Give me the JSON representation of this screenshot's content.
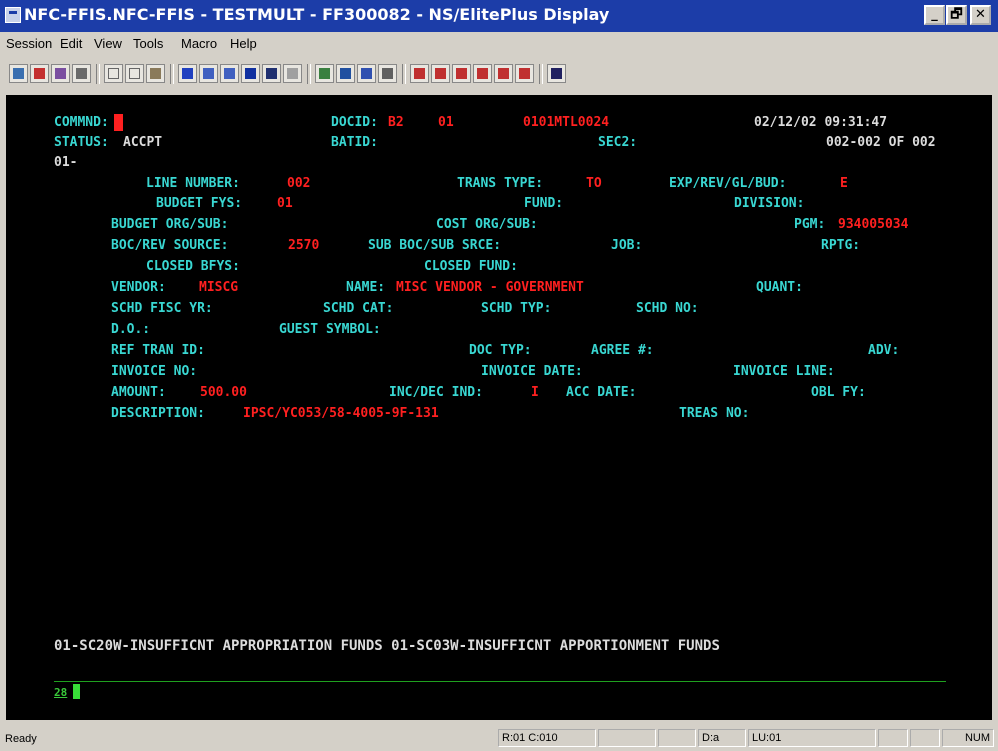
{
  "window": {
    "title": "NFC-FFIS.NFC-FFIS - TESTMULT - FF300082 - NS/ElitePlus Display",
    "minimize": "_",
    "maximize": "🗗",
    "close": "✕"
  },
  "menu": {
    "session": "Session",
    "edit": "Edit",
    "view": "View",
    "tools": "Tools",
    "macro": "Macro",
    "help": "Help"
  },
  "toolbar_icons": [
    "send-icon",
    "receive-icon",
    "copy-screen-icon",
    "print-icon",
    "cut-icon",
    "copy-icon",
    "paste-icon",
    "font-icon",
    "zoom-in-icon",
    "zoom-out-icon",
    "display-icon",
    "fit-icon",
    "connect-icon",
    "settings-icon",
    "capture-icon",
    "table-icon",
    "record-icon",
    "macro1-icon",
    "macro2-icon",
    "macro3-icon",
    "macro4-icon",
    "macro5-icon",
    "macro6-icon",
    "help-pointer-icon"
  ],
  "screen": {
    "commnd_label": "COMMND:",
    "docid_label": "DOCID:",
    "docid_1": "B2",
    "docid_2": "01",
    "docid_3": "0101MTL0024",
    "datetime": "02/12/02 09:31:47",
    "status_label": "STATUS:",
    "status_value": "ACCPT",
    "batid_label": "BATID:",
    "sec2_label": "SEC2:",
    "page_info": "002-002 OF 002",
    "section": "01-",
    "line_number_label": "LINE NUMBER:",
    "line_number": "002",
    "trans_type_label": "TRANS TYPE:",
    "trans_type": "TO",
    "exp_label": "EXP/REV/GL/BUD:",
    "exp_value": "E",
    "budget_fys_label": "BUDGET FYS:",
    "budget_fys": "01",
    "fund_label": "FUND:",
    "division_label": "DIVISION:",
    "budget_org_label": "BUDGET ORG/SUB:",
    "cost_org_label": "COST ORG/SUB:",
    "pgm_label": "PGM:",
    "pgm_value": "934005034",
    "boc_label": "BOC/REV SOURCE:",
    "boc_value": "2570",
    "sub_boc_label": "SUB BOC/SUB SRCE:",
    "job_label": "JOB:",
    "rptg_label": "RPTG:",
    "closed_bfys_label": "CLOSED BFYS:",
    "closed_fund_label": "CLOSED FUND:",
    "vendor_label": "VENDOR:",
    "vendor_value": "MISCG",
    "name_label": "NAME:",
    "name_value": "MISC VENDOR - GOVERNMENT",
    "quant_label": "QUANT:",
    "schd_fisc_label": "SCHD FISC YR:",
    "schd_cat_label": "SCHD CAT:",
    "schd_typ_label": "SCHD TYP:",
    "schd_no_label": "SCHD NO:",
    "do_label": "D.O.:",
    "guest_symbol_label": "GUEST SYMBOL:",
    "ref_tran_label": "REF TRAN ID:",
    "doc_typ_label": "DOC TYP:",
    "agree_label": "AGREE #:",
    "adv_label": "ADV:",
    "invoice_no_label": "INVOICE NO:",
    "invoice_date_label": "INVOICE DATE:",
    "invoice_line_label": "INVOICE LINE:",
    "amount_label": "AMOUNT:",
    "amount_value": "500.00",
    "incdec_label": "INC/DEC IND:",
    "incdec_value": "I",
    "acc_date_label": "ACC DATE:",
    "obl_fy_label": "OBL FY:",
    "description_label": "DESCRIPTION:",
    "description_value": "IPSC/YC053/58-4005-9F-131",
    "treas_no_label": "TREAS NO:",
    "message": "01-SC20W-INSUFFICNT APPROPRIATION FUNDS 01-SC03W-INSUFFICNT APPORTIONMENT FUNDS",
    "input_prefix": "28"
  },
  "statusbar": {
    "ready": "Ready",
    "rowcol": "R:01 C:010",
    "d_field": "D:a",
    "lu_field": "LU:01",
    "num": "NUM"
  }
}
